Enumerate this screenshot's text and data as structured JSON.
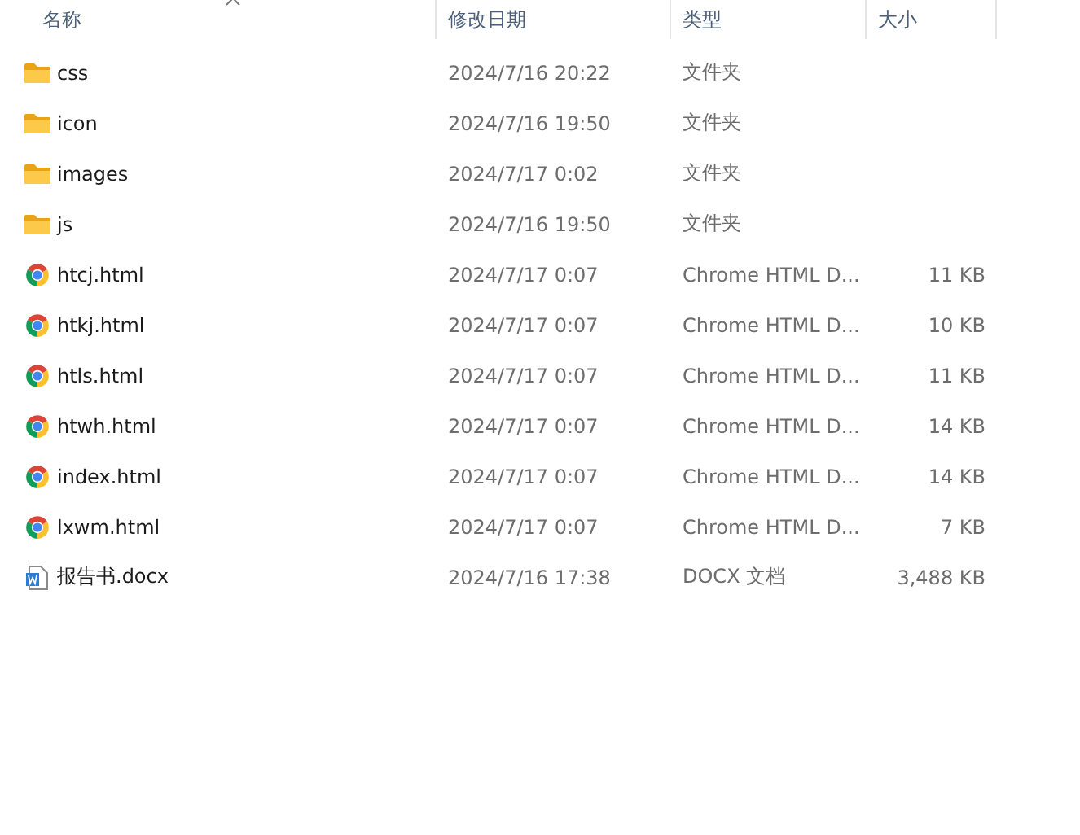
{
  "columns": [
    {
      "label": "名称",
      "sorted": true
    },
    {
      "label": "修改日期",
      "sorted": false
    },
    {
      "label": "类型",
      "sorted": false
    },
    {
      "label": "大小",
      "sorted": false
    }
  ],
  "rows": [
    {
      "kind": "folder",
      "name": "css",
      "modified": "2024/7/16 20:22",
      "type": "文件夹"
    },
    {
      "kind": "folder",
      "name": "icon",
      "modified": "2024/7/16 19:50",
      "type": "文件夹"
    },
    {
      "kind": "folder",
      "name": "images",
      "modified": "2024/7/17 0:02",
      "type": "文件夹"
    },
    {
      "kind": "folder",
      "name": "js",
      "modified": "2024/7/16 19:50",
      "type": "文件夹"
    },
    {
      "kind": "chrome",
      "name": "htcj.html",
      "modified": "2024/7/17 0:07",
      "type": "Chrome HTML D...",
      "size": "11 KB"
    },
    {
      "kind": "chrome",
      "name": "htkj.html",
      "modified": "2024/7/17 0:07",
      "type": "Chrome HTML D...",
      "size": "10 KB"
    },
    {
      "kind": "chrome",
      "name": "htls.html",
      "modified": "2024/7/17 0:07",
      "type": "Chrome HTML D...",
      "size": "11 KB"
    },
    {
      "kind": "chrome",
      "name": "htwh.html",
      "modified": "2024/7/17 0:07",
      "type": "Chrome HTML D...",
      "size": "14 KB"
    },
    {
      "kind": "chrome",
      "name": "index.html",
      "modified": "2024/7/17 0:07",
      "type": "Chrome HTML D...",
      "size": "14 KB"
    },
    {
      "kind": "chrome",
      "name": "lxwm.html",
      "modified": "2024/7/17 0:07",
      "type": "Chrome HTML D...",
      "size": "7 KB"
    },
    {
      "kind": "word",
      "name": "报告书.docx",
      "modified": "2024/7/16 17:38",
      "type": "DOCX 文档",
      "size": "3,488 KB"
    }
  ]
}
